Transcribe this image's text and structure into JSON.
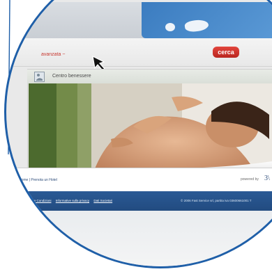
{
  "header": {
    "advanced_search_link": "avanzata ~",
    "search_button": "cerca"
  },
  "panel": {
    "title": "Centro benessere",
    "icon": "spa-icon"
  },
  "footer": {
    "nav_links": "Home | Prenota un Hotel",
    "powered_by": "powered by",
    "powered_logo": "3\\",
    "legal_links": [
      "Termini e Condizioni",
      "Informative sulla privacy",
      "Dati Societari"
    ],
    "copyright": "© 2006 Fast Service srl, partita iva 03600661001 T"
  },
  "colors": {
    "accent_blue": "#2a5a95",
    "search_red": "#c7372f",
    "lens_border": "#1f5fa8"
  }
}
